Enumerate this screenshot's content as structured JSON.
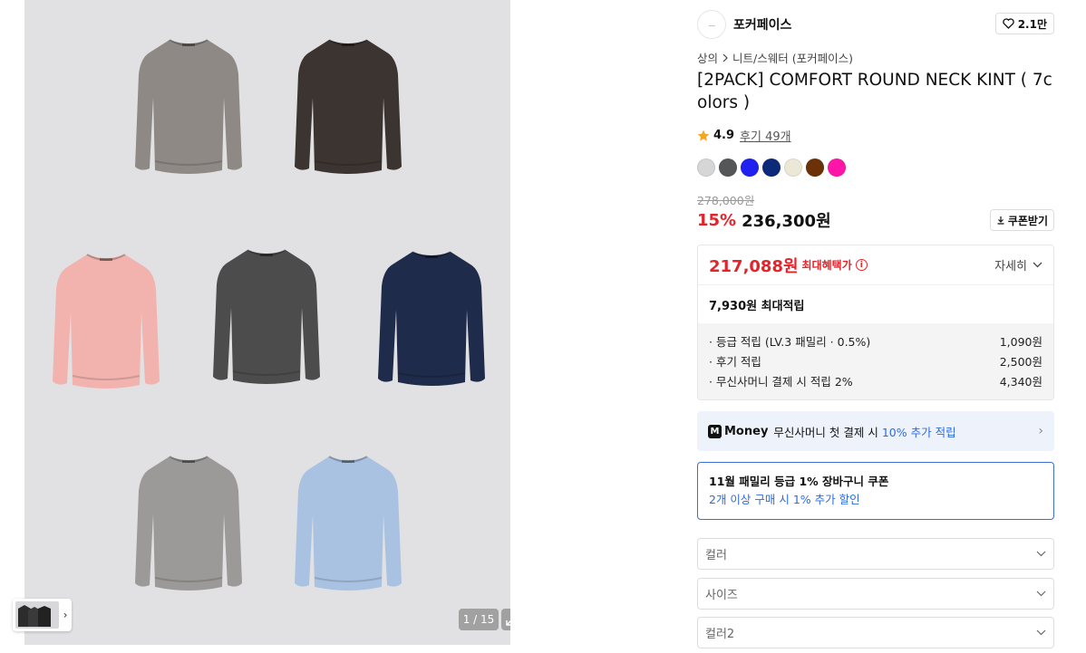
{
  "gallery": {
    "page_indicator": "1 / 15",
    "sweaters": [
      {
        "color": "#8f8986",
        "name": "sweater-gray-brown"
      },
      {
        "color": "#3b3430",
        "name": "sweater-dark-brown"
      },
      {
        "color": "#f2b3ae",
        "name": "sweater-pink"
      },
      {
        "color": "#4c4c4c",
        "name": "sweater-charcoal"
      },
      {
        "color": "#1f2b4a",
        "name": "sweater-navy"
      },
      {
        "color": "#9c9a98",
        "name": "sweater-light-gray"
      },
      {
        "color": "#a9c2e2",
        "name": "sweater-sky-blue"
      }
    ]
  },
  "brand": {
    "logo_text": "........",
    "name": "포커페이스",
    "likes": "2.1만"
  },
  "breadcrumb": {
    "level1": "상의",
    "level2": "니트/스웨터 (포커페이스)"
  },
  "product": {
    "title": "[2PACK] COMFORT ROUND NECK KINT ( 7colors )",
    "rating": "4.9",
    "reviews": "후기 49개",
    "swatches": [
      "#d6d6d6",
      "#555658",
      "#2020f0",
      "#0d2a7a",
      "#ece8d8",
      "#6b3208",
      "#ff16a8"
    ],
    "original_price": "278,000원",
    "discount": "15%",
    "price": "236,300원",
    "coupon_button": "쿠폰받기"
  },
  "benefit": {
    "max_price": "217,088원",
    "max_label": "최대혜택가",
    "detail_label": "자세히",
    "points_summary": "7,930원 최대적립",
    "items": [
      {
        "label": "· 등급 적립 (LV.3 패밀리 · 0.5%)",
        "value": "1,090원"
      },
      {
        "label": "· 후기 적립",
        "value": "2,500원"
      },
      {
        "label": "· 무신사머니 결제 시 적립 2%",
        "value": "4,340원"
      }
    ]
  },
  "money_banner": {
    "logo": "M",
    "word": "Money",
    "text": "무신사머니 첫 결제 시",
    "highlight": "10% 추가 적립"
  },
  "coupon": {
    "title": "11월 패밀리 등급 1% 장바구니 쿠폰",
    "subtitle": "2개 이상 구매 시 1% 추가 할인"
  },
  "options": {
    "color": "컬러",
    "size": "사이즈",
    "color2": "컬러2"
  }
}
